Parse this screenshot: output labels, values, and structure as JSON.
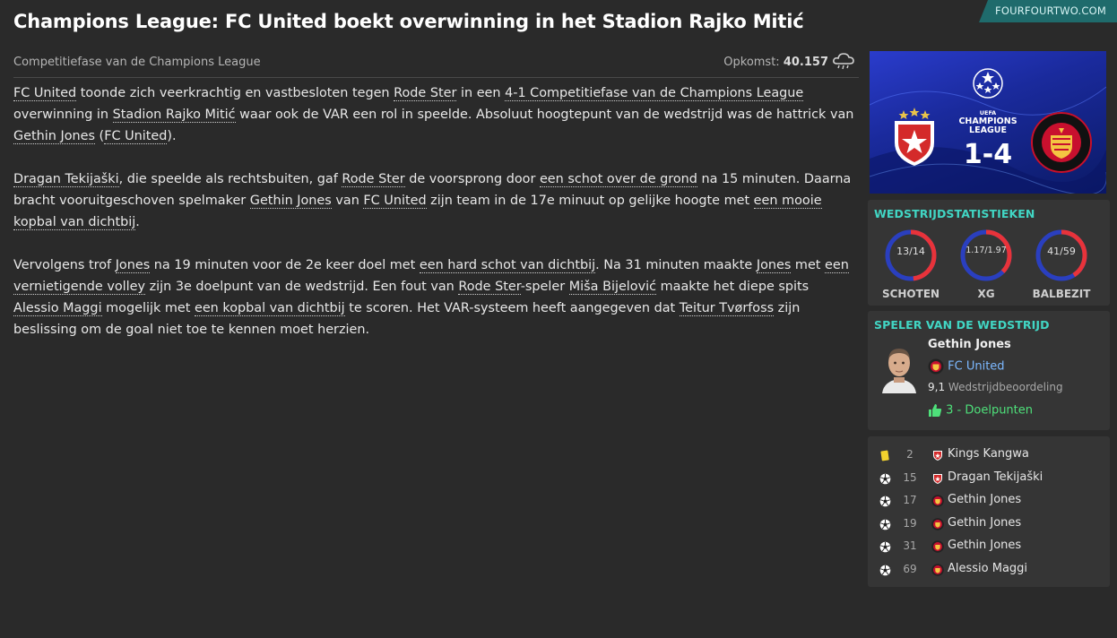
{
  "header": {
    "title": "Champions League: FC United boekt overwinning in het Stadion Rajko Mitić",
    "source": "FOURFOURTWO.COM"
  },
  "subheader": {
    "competition": "Competitiefase van de Champions League",
    "attendance_label": "Opkomst:",
    "attendance_value": "40.157",
    "weather_icon": "cloud-rain-icon"
  },
  "article": {
    "p1": {
      "team1": "FC United",
      "t1": " toonde zich veerkrachtig en vastbesloten tegen ",
      "opponent": "Rode Ster",
      "t2": " in een ",
      "result": "4-1 Competitiefase van de Champions League",
      "t3": " overwinning in ",
      "stadium": "Stadion Rajko Mitić",
      "t4": " waar ook de VAR een rol in speelde. Absoluut hoogtepunt van de wedstrijd was de hattrick van ",
      "player": "Gethin Jones",
      "t5": " (",
      "team2": "FC United",
      "t6": ")."
    },
    "p2": {
      "player1": "Dragan Tekijaški",
      "t1": ", die speelde als rechtsbuiten, gaf ",
      "team1": "Rode Ster",
      "t2": " de voorsprong door ",
      "goal1": "een schot over de grond",
      "t3": " na 15 minuten. Daarna bracht vooruitgeschoven spelmaker ",
      "player2": "Gethin Jones",
      "t4": " van ",
      "team2": "FC United",
      "t5": " zijn team in de 17e minuut op gelijke hoogte met ",
      "goal2": "een mooie kopbal van dichtbij",
      "t6": "."
    },
    "p3": {
      "t1": "Vervolgens trof ",
      "player1": "Jones",
      "t2": " na 19 minuten voor de 2e keer doel met ",
      "goal1": "een hard schot van dichtbij",
      "t3": ". Na 31 minuten maakte ",
      "player2": "Jones",
      "t4": " met ",
      "goal2": "een vernietigende volley",
      "t5": " zijn 3e doelpunt van de wedstrijd. Een fout van ",
      "team1": "Rode Ster",
      "t6": "-speler ",
      "player3": "Miša Bijelović",
      "t7": " maakte het diepe spits ",
      "player4": "Alessio Maggi",
      "t8": " mogelijk met ",
      "goal3": "een kopbal van dichtbij",
      "t9": " te scoren. Het VAR-systeem heeft aangegeven dat ",
      "referee": "Teitur Tvørfoss",
      "t10": " zijn beslissing om de goal niet toe te kennen moet herzien."
    }
  },
  "banner": {
    "competition_line1": "UEFA",
    "competition_line2": "CHAMPIONS",
    "competition_line3": "LEAGUE",
    "score": "1-4",
    "home_crest": "red-star-crest-icon",
    "away_crest": "fc-united-crest-icon",
    "colors": {
      "home": "#d42a2a",
      "away": "#c8102e",
      "bg": "#1a2a9c"
    }
  },
  "stats": {
    "title": "WEDSTRIJDSTATISTIEKEN",
    "items": [
      {
        "label": "SCHOTEN",
        "value": "13/14",
        "home": 13,
        "away": 14
      },
      {
        "label": "XG",
        "value": "1.17/1.97",
        "home": 1.17,
        "away": 1.97
      },
      {
        "label": "BALBEZIT",
        "value": "41/59",
        "home": 41,
        "away": 59
      }
    ],
    "colors": {
      "home": "#e8333a",
      "away": "#2a3fbf"
    }
  },
  "potm": {
    "title": "SPELER VAN DE WEDSTRIJD",
    "name": "Gethin Jones",
    "club": "FC United",
    "rating_value": "9,1",
    "rating_label": "Wedstrijdbeoordeling",
    "goals": "3 - Doelpunten"
  },
  "events": [
    {
      "type": "yellow-card-icon",
      "minute": "2",
      "team": "red-star-crest-icon",
      "player": "Kings Kangwa"
    },
    {
      "type": "ball-icon",
      "minute": "15",
      "team": "red-star-crest-icon",
      "player": "Dragan Tekijaški"
    },
    {
      "type": "ball-icon",
      "minute": "17",
      "team": "fc-united-crest-icon",
      "player": "Gethin Jones"
    },
    {
      "type": "ball-icon",
      "minute": "19",
      "team": "fc-united-crest-icon",
      "player": "Gethin Jones"
    },
    {
      "type": "ball-icon",
      "minute": "31",
      "team": "fc-united-crest-icon",
      "player": "Gethin Jones"
    },
    {
      "type": "ball-icon",
      "minute": "69",
      "team": "fc-united-crest-icon",
      "player": "Alessio Maggi"
    }
  ]
}
